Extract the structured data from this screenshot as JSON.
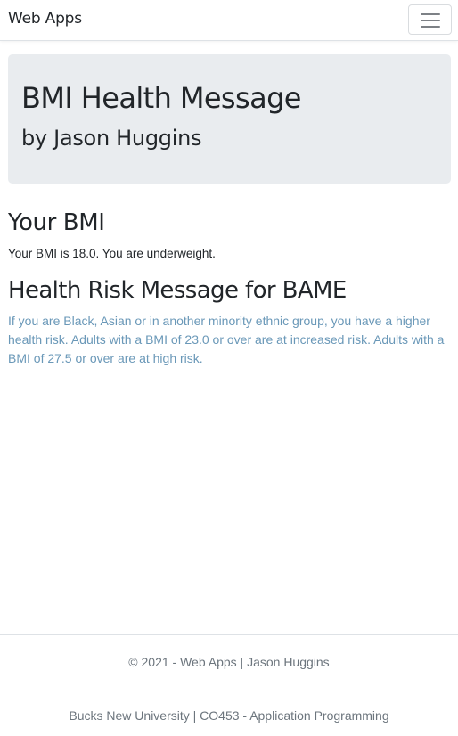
{
  "navbar": {
    "brand": "Web Apps",
    "toggler_icon": "hamburger-menu-icon"
  },
  "jumbotron": {
    "title": "BMI Health Message",
    "subtitle": "by Jason Huggins"
  },
  "bmi_section": {
    "heading": "Your BMI",
    "text": "Your BMI is 18.0. You are underweight."
  },
  "risk_section": {
    "heading": "Health Risk Message for BAME",
    "text": "If you are Black, Asian or in another minority ethnic group, you have a higher health risk. Adults with a BMI of 23.0 or over are at increased risk. Adults with a BMI of 27.5 or over are at high risk."
  },
  "footer": {
    "copyright": "© 2021 - Web Apps | Jason Huggins",
    "course": "Bucks New University | CO453 - Application Programming"
  },
  "colors": {
    "jumbotron_bg": "#e9ecef",
    "risk_text": "#6a98b8",
    "footer_text": "#6c757d"
  }
}
